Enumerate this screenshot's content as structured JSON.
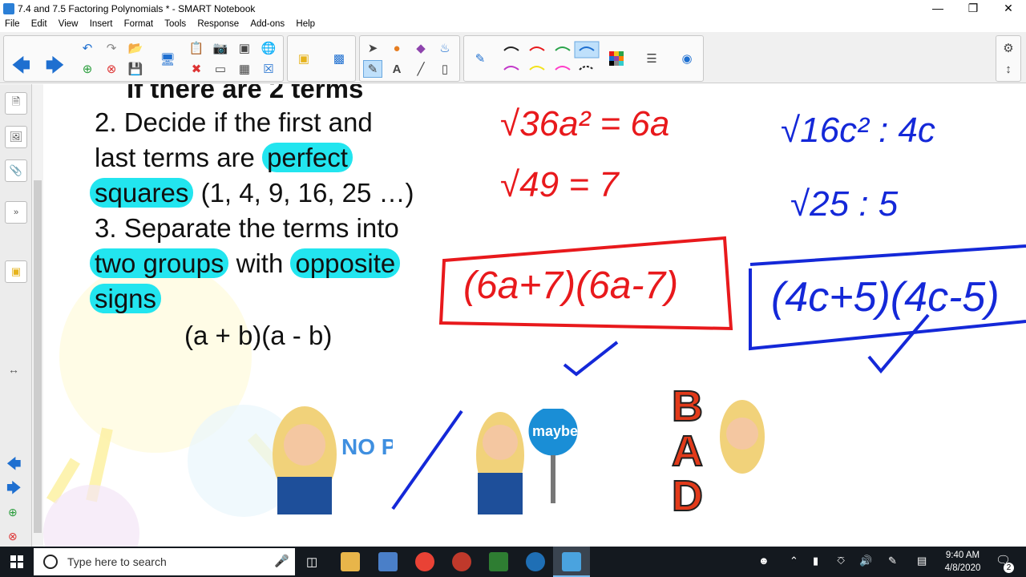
{
  "window": {
    "title": "7.4 and 7.5 Factoring Polynomials * - SMART Notebook"
  },
  "menu": [
    "File",
    "Edit",
    "View",
    "Insert",
    "Format",
    "Tools",
    "Response",
    "Add-ons",
    "Help"
  ],
  "slide": {
    "heading_partial": "If there are 2 terms",
    "line2a": "2.  Decide if the first and",
    "line2b_pre": "last terms are ",
    "line2b_hl": "perfect",
    "line2c_hl": "squares",
    "line2c_post": " (1, 4, 9, 16, 25 …)",
    "line3a": "3.  Separate the terms into",
    "line3b_hl": "two groups",
    "line3b_mid": " with ",
    "line3b_hl2": "opposite",
    "line3c_hl": "signs",
    "formula": "(a + b)(a - b)"
  },
  "handwriting": {
    "red1": "√36a² = 6a",
    "red2": "√49 = 7",
    "red3": "(6a+7)(6a-7)",
    "blue1": "√16c² : 4c",
    "blue2": "√25 : 5",
    "blue3": "(4c+5)(4c-5)"
  },
  "stickers": {
    "no_prob": "NO PROB",
    "maybe": "maybe",
    "bad_b": "B",
    "bad_a": "A",
    "bad_d": "D"
  },
  "taskbar": {
    "search_placeholder": "Type here to search",
    "time": "9:40 AM",
    "date": "4/8/2020",
    "notifications": "2"
  },
  "colors": {
    "highlight": "#22e5ef",
    "ink_red": "#e8191c",
    "ink_blue": "#1428d8"
  }
}
